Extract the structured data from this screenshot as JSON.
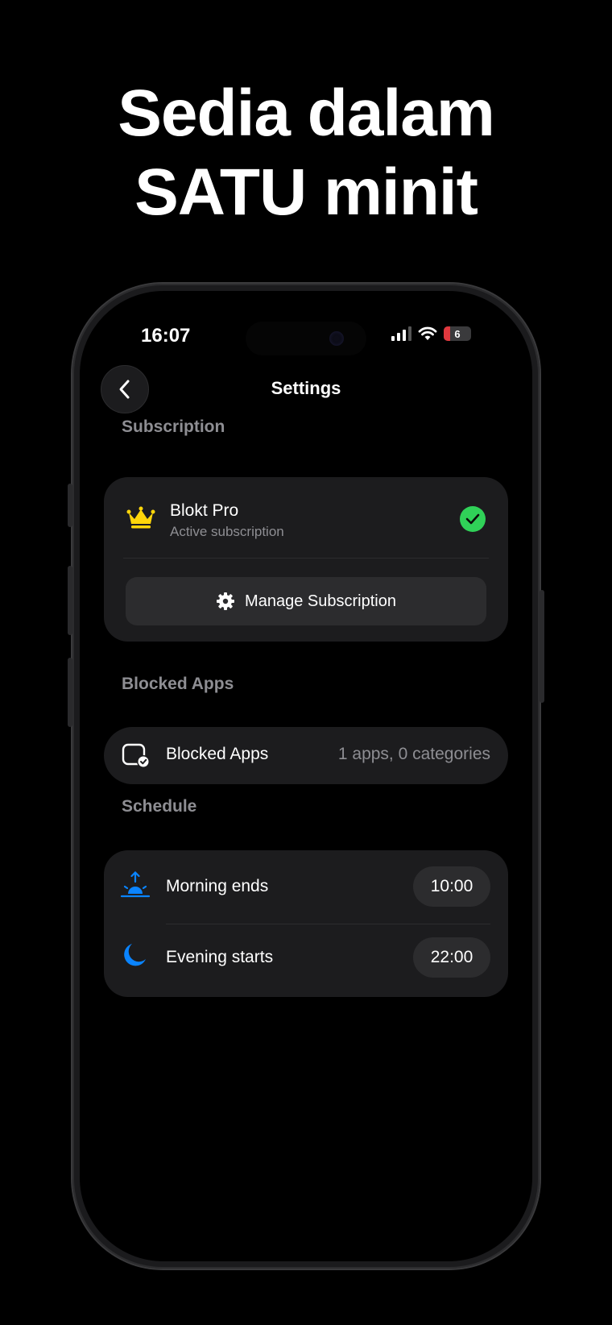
{
  "headline": {
    "line1": "Sedia dalam",
    "line2": "SATU minit"
  },
  "status_bar": {
    "time": "16:07",
    "battery": "6"
  },
  "nav": {
    "title": "Settings"
  },
  "subscription": {
    "section_label": "Subscription",
    "plan_name": "Blokt Pro",
    "plan_status": "Active subscription",
    "manage_label": "Manage Subscription"
  },
  "blocked_apps": {
    "section_label": "Blocked Apps",
    "row_label": "Blocked Apps",
    "row_value": "1 apps, 0 categories"
  },
  "schedule": {
    "section_label": "Schedule",
    "items": [
      {
        "label": "Morning ends",
        "time": "10:00",
        "icon": "sunrise-icon"
      },
      {
        "label": "Evening starts",
        "time": "22:00",
        "icon": "moon-icon"
      }
    ]
  },
  "colors": {
    "accent_blue": "#0a84ff",
    "success_green": "#30d158",
    "crown_gold": "#ffd60a",
    "battery_low": "#e0383e"
  }
}
